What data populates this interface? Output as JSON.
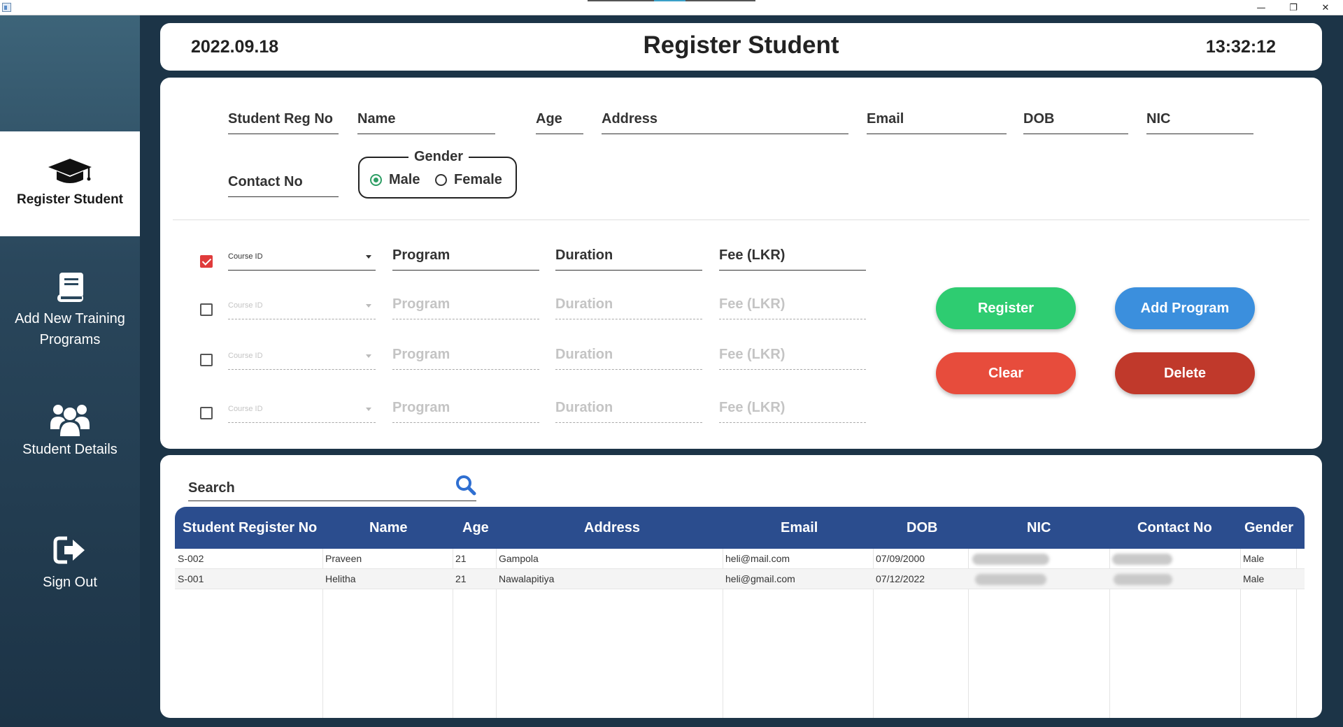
{
  "window": {
    "minimize_glyph": "—",
    "maximize_glyph": "❐",
    "close_glyph": "✕"
  },
  "sidebar": {
    "items": [
      {
        "label": "Register Student",
        "icon": "graduation-cap-icon",
        "active": true
      },
      {
        "label": "Add New Training Programs",
        "icon": "book-icon",
        "active": false
      },
      {
        "label": "Student Details",
        "icon": "users-icon",
        "active": false
      },
      {
        "label": "Sign Out",
        "icon": "sign-out-icon",
        "active": false
      }
    ]
  },
  "header": {
    "date": "2022.09.18",
    "title": "Register Student",
    "time": "13:32:12"
  },
  "form": {
    "reg_no": "Student Reg No",
    "name": "Name",
    "age": "Age",
    "address": "Address",
    "email": "Email",
    "dob": "DOB",
    "nic": "NIC",
    "contact_no": "Contact No",
    "gender": {
      "legend": "Gender",
      "options": [
        "Male",
        "Female"
      ],
      "selected": "Male"
    },
    "courses": [
      {
        "checked": true,
        "course_id": "Course ID",
        "program": "Program",
        "duration": "Duration",
        "fee": "Fee (LKR)"
      },
      {
        "checked": false,
        "course_id": "Course ID",
        "program": "Program",
        "duration": "Duration",
        "fee": "Fee (LKR)"
      },
      {
        "checked": false,
        "course_id": "Course ID",
        "program": "Program",
        "duration": "Duration",
        "fee": "Fee (LKR)"
      },
      {
        "checked": false,
        "course_id": "Course ID",
        "program": "Program",
        "duration": "Duration",
        "fee": "Fee (LKR)"
      }
    ],
    "buttons": {
      "register": "Register",
      "add_program": "Add Program",
      "clear": "Clear",
      "delete": "Delete"
    }
  },
  "colors": {
    "register": "#2ecc71",
    "add_program": "#3b8fdd",
    "clear": "#e74c3c",
    "delete": "#c0392b",
    "table_header": "#2b4d8e"
  },
  "search": {
    "placeholder": "Search",
    "icon": "search-icon"
  },
  "table": {
    "columns": [
      "Student Register No",
      "Name",
      "Age",
      "Address",
      "Email",
      "DOB",
      "NIC",
      "Contact No",
      "Gender"
    ],
    "rows": [
      {
        "reg_no": "S-002",
        "name": "Praveen",
        "age": "21",
        "address": "Gampola",
        "email": "heli@mail.com",
        "dob": "07/09/2000",
        "gender": "Male"
      },
      {
        "reg_no": "S-001",
        "name": "Helitha",
        "age": "21",
        "address": "Nawalapitiya",
        "email": "heli@gmail.com",
        "dob": "07/12/2022",
        "gender": "Male"
      }
    ]
  }
}
